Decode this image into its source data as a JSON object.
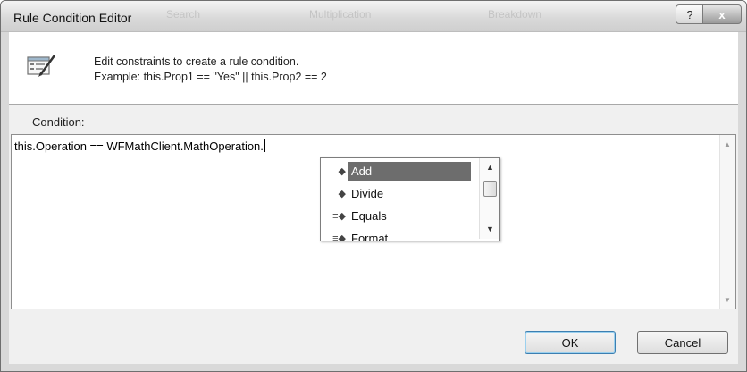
{
  "window": {
    "title": "Rule Condition Editor",
    "help_glyph": "?",
    "close_glyph": "x",
    "ghost_tabs": [
      "Search",
      "Multiplication",
      "Breakdown"
    ]
  },
  "header": {
    "icon": "rule-edit-icon",
    "line1": "Edit constraints to create a rule condition.",
    "line2": "Example: this.Prop1 == \"Yes\" || this.Prop2 == 2"
  },
  "condition": {
    "label": "Condition:",
    "text": "this.Operation == WFMathClient.MathOperation."
  },
  "intellisense": {
    "items": [
      {
        "label": "Add",
        "icon": "enum-member-icon",
        "selected": true
      },
      {
        "label": "Divide",
        "icon": "enum-member-icon",
        "selected": false
      },
      {
        "label": "Equals",
        "icon": "method-icon",
        "selected": false
      },
      {
        "label": "Format",
        "icon": "method-icon",
        "selected": false
      }
    ]
  },
  "buttons": {
    "ok": "OK",
    "cancel": "Cancel"
  },
  "colors": {
    "selection": "#6d6d6d",
    "dialog_bg": "#f0f0f0",
    "default_button_border": "#3c7fb1"
  }
}
